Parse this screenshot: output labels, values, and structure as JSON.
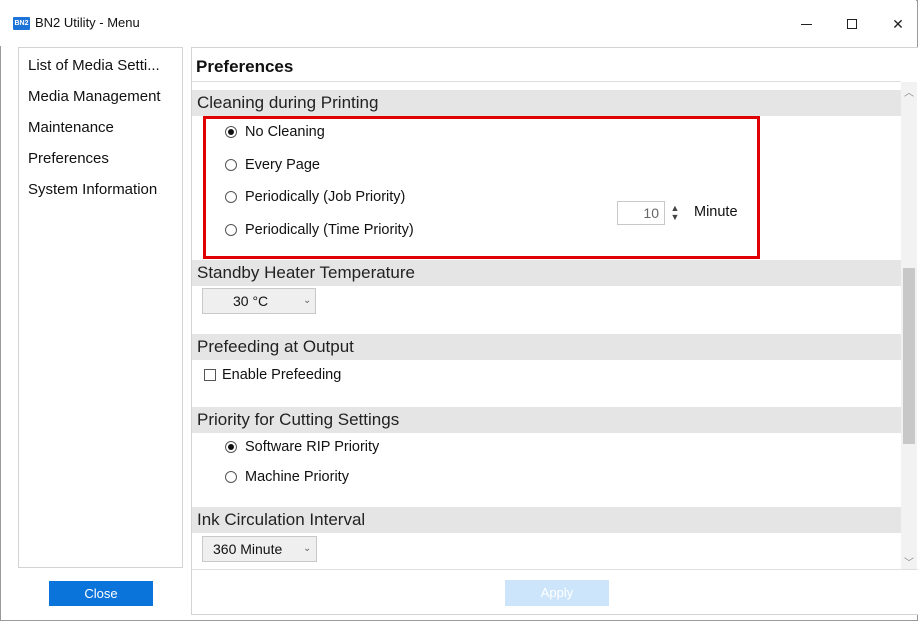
{
  "window": {
    "title": "BN2 Utility - Menu",
    "icon_text": "BN2"
  },
  "nav": {
    "items": [
      {
        "label": "List of Media Setti..."
      },
      {
        "label": "Media Management"
      },
      {
        "label": "Maintenance"
      },
      {
        "label": "Preferences"
      },
      {
        "label": "System Information"
      }
    ]
  },
  "panel": {
    "title": "Preferences",
    "cleaning": {
      "header": "Cleaning during Printing",
      "options": [
        {
          "label": "No Cleaning",
          "checked": true
        },
        {
          "label": "Every Page",
          "checked": false
        },
        {
          "label": "Periodically (Job Priority)",
          "checked": false
        },
        {
          "label": "Periodically (Time Priority)",
          "checked": false
        }
      ],
      "interval_value": "10",
      "interval_unit": "Minute"
    },
    "standby": {
      "header": "Standby Heater Temperature",
      "selected": "30 °C"
    },
    "prefeed": {
      "header": "Prefeeding at Output",
      "checkbox_label": "Enable Prefeeding",
      "checked": false
    },
    "cutting": {
      "header": "Priority for Cutting Settings",
      "options": [
        {
          "label": "Software RIP Priority",
          "checked": true
        },
        {
          "label": "Machine Priority",
          "checked": false
        }
      ]
    },
    "ink": {
      "header": "Ink Circulation Interval",
      "selected": "360 Minute"
    }
  },
  "buttons": {
    "close": "Close",
    "apply": "Apply"
  },
  "colors": {
    "accent": "#0a74da",
    "highlight": "#e10000",
    "apply_disabled": "#cde5fb"
  }
}
